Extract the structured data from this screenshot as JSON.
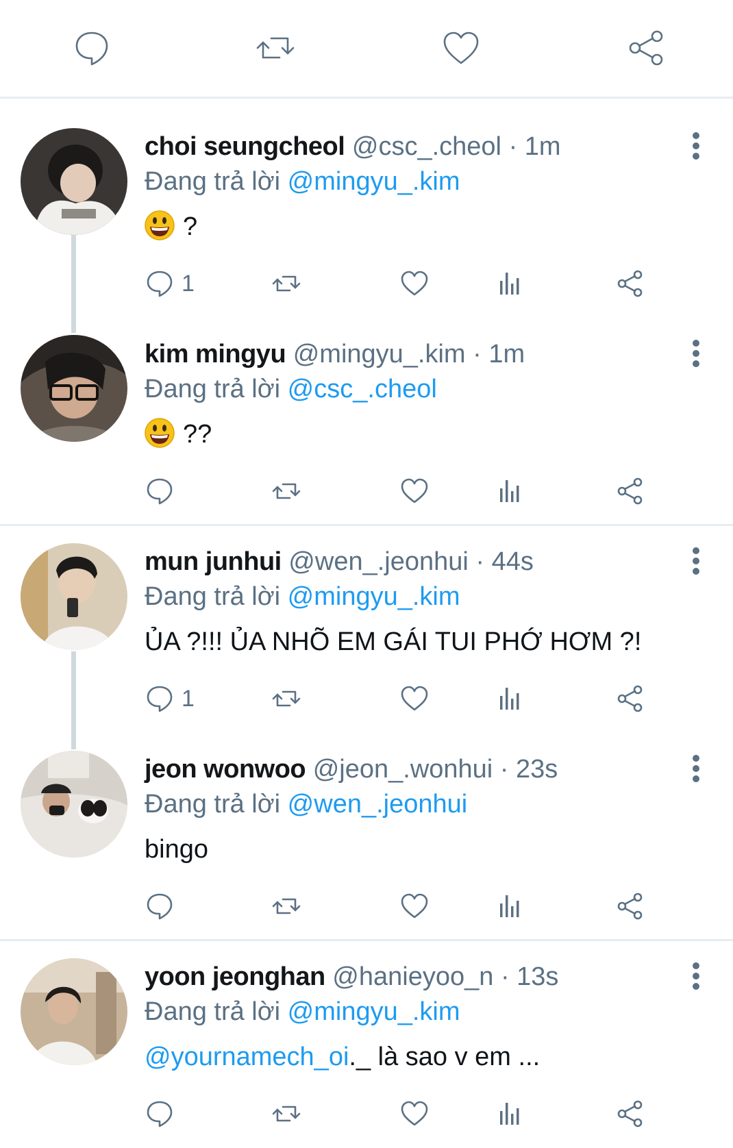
{
  "top_actions": [
    "reply",
    "retweet",
    "like",
    "share"
  ],
  "reply_prefix": "Đang trả lời",
  "tweets": [
    {
      "name": "choi seungcheol",
      "handle": "@csc_.cheol",
      "time": "1m",
      "reply_to": "@mingyu_.kim",
      "emoji": "grinning-face",
      "text": "?",
      "mention": "",
      "reply_count": "1"
    },
    {
      "name": "kim mingyu",
      "handle": "@mingyu_.kim",
      "time": "1m",
      "reply_to": "@csc_.cheol",
      "emoji": "grinning-face",
      "text": "??",
      "mention": "",
      "reply_count": ""
    },
    {
      "name": "mun junhui",
      "handle": "@wen_.jeonhui",
      "time": "44s",
      "reply_to": "@mingyu_.kim",
      "emoji": "",
      "text": "ỦA ?!!! ỦA NHÕ EM GÁI TUI PHỚ HƠM ?!",
      "mention": "",
      "reply_count": "1"
    },
    {
      "name": "jeon wonwoo",
      "handle": "@jeon_.wonhui",
      "time": "23s",
      "reply_to": "@wen_.jeonhui",
      "emoji": "",
      "text": "bingo",
      "mention": "",
      "reply_count": ""
    },
    {
      "name": "yoon jeonghan",
      "handle": "@hanieyoo_n",
      "time": "13s",
      "reply_to": "@mingyu_.kim",
      "emoji": "",
      "text": "._ là sao v em ...",
      "mention": "@yournamech_oi",
      "reply_count": ""
    }
  ]
}
